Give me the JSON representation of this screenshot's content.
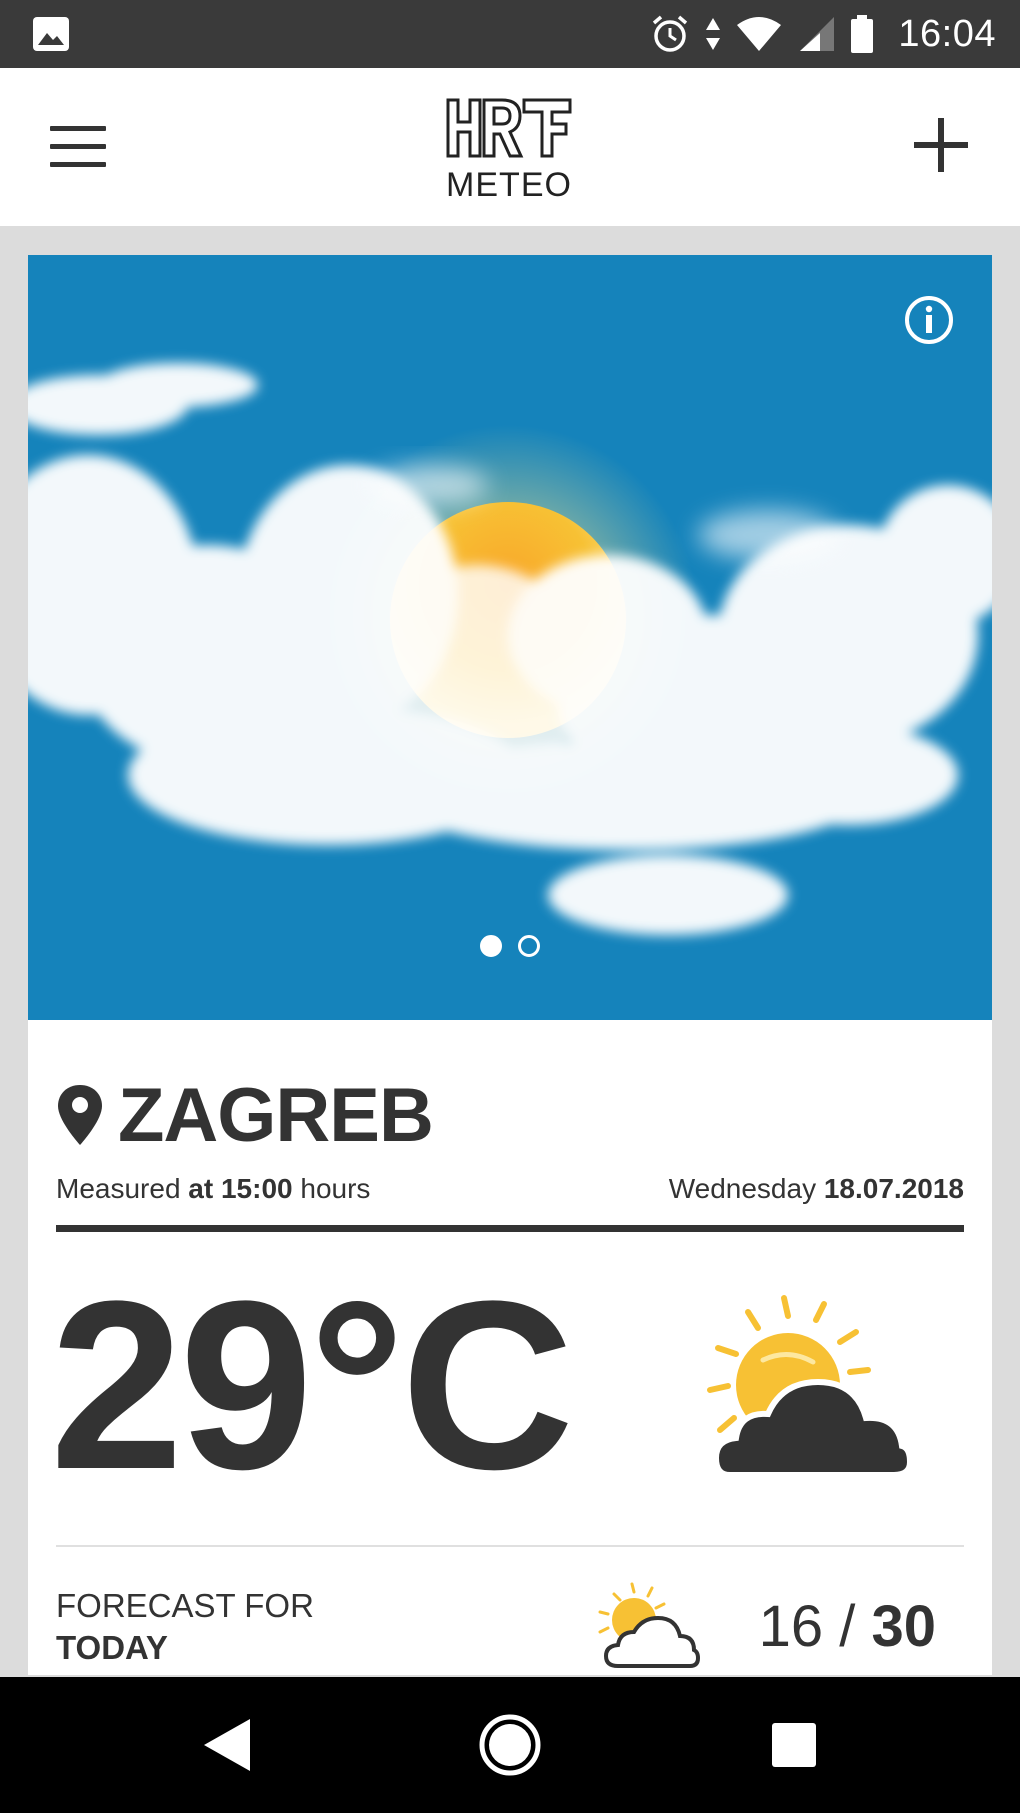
{
  "status_bar": {
    "time": "16:04",
    "icons": [
      "image-icon",
      "alarm-icon",
      "data-arrows-icon",
      "wifi-icon",
      "signal-icon",
      "battery-icon"
    ]
  },
  "app_bar": {
    "logo_mark": "HRT",
    "logo_text": "METEO",
    "icons": [
      "menu-icon",
      "add-icon"
    ]
  },
  "hero": {
    "icon": "info-icon",
    "pager": {
      "total": 2,
      "active": 1
    },
    "colors": {
      "sky": "#1583bb",
      "sun": "#f7c134"
    }
  },
  "location": {
    "city": "ZAGREB",
    "measured_prefix": "Measured",
    "measured_time": "at 15:00",
    "measured_suffix": "hours",
    "weekday": "Wednesday",
    "date": "18.07.2018"
  },
  "current": {
    "temperature": "29°C",
    "icon": "partly-cloudy-icon"
  },
  "forecast": {
    "label_line1": "FORECAST FOR",
    "label_line2": "TODAY",
    "min": "16",
    "separator": "/",
    "max": "30",
    "icon": "partly-cloudy-small-icon"
  },
  "nav_bar": {
    "icons": [
      "back-icon",
      "home-icon",
      "recents-icon"
    ]
  }
}
